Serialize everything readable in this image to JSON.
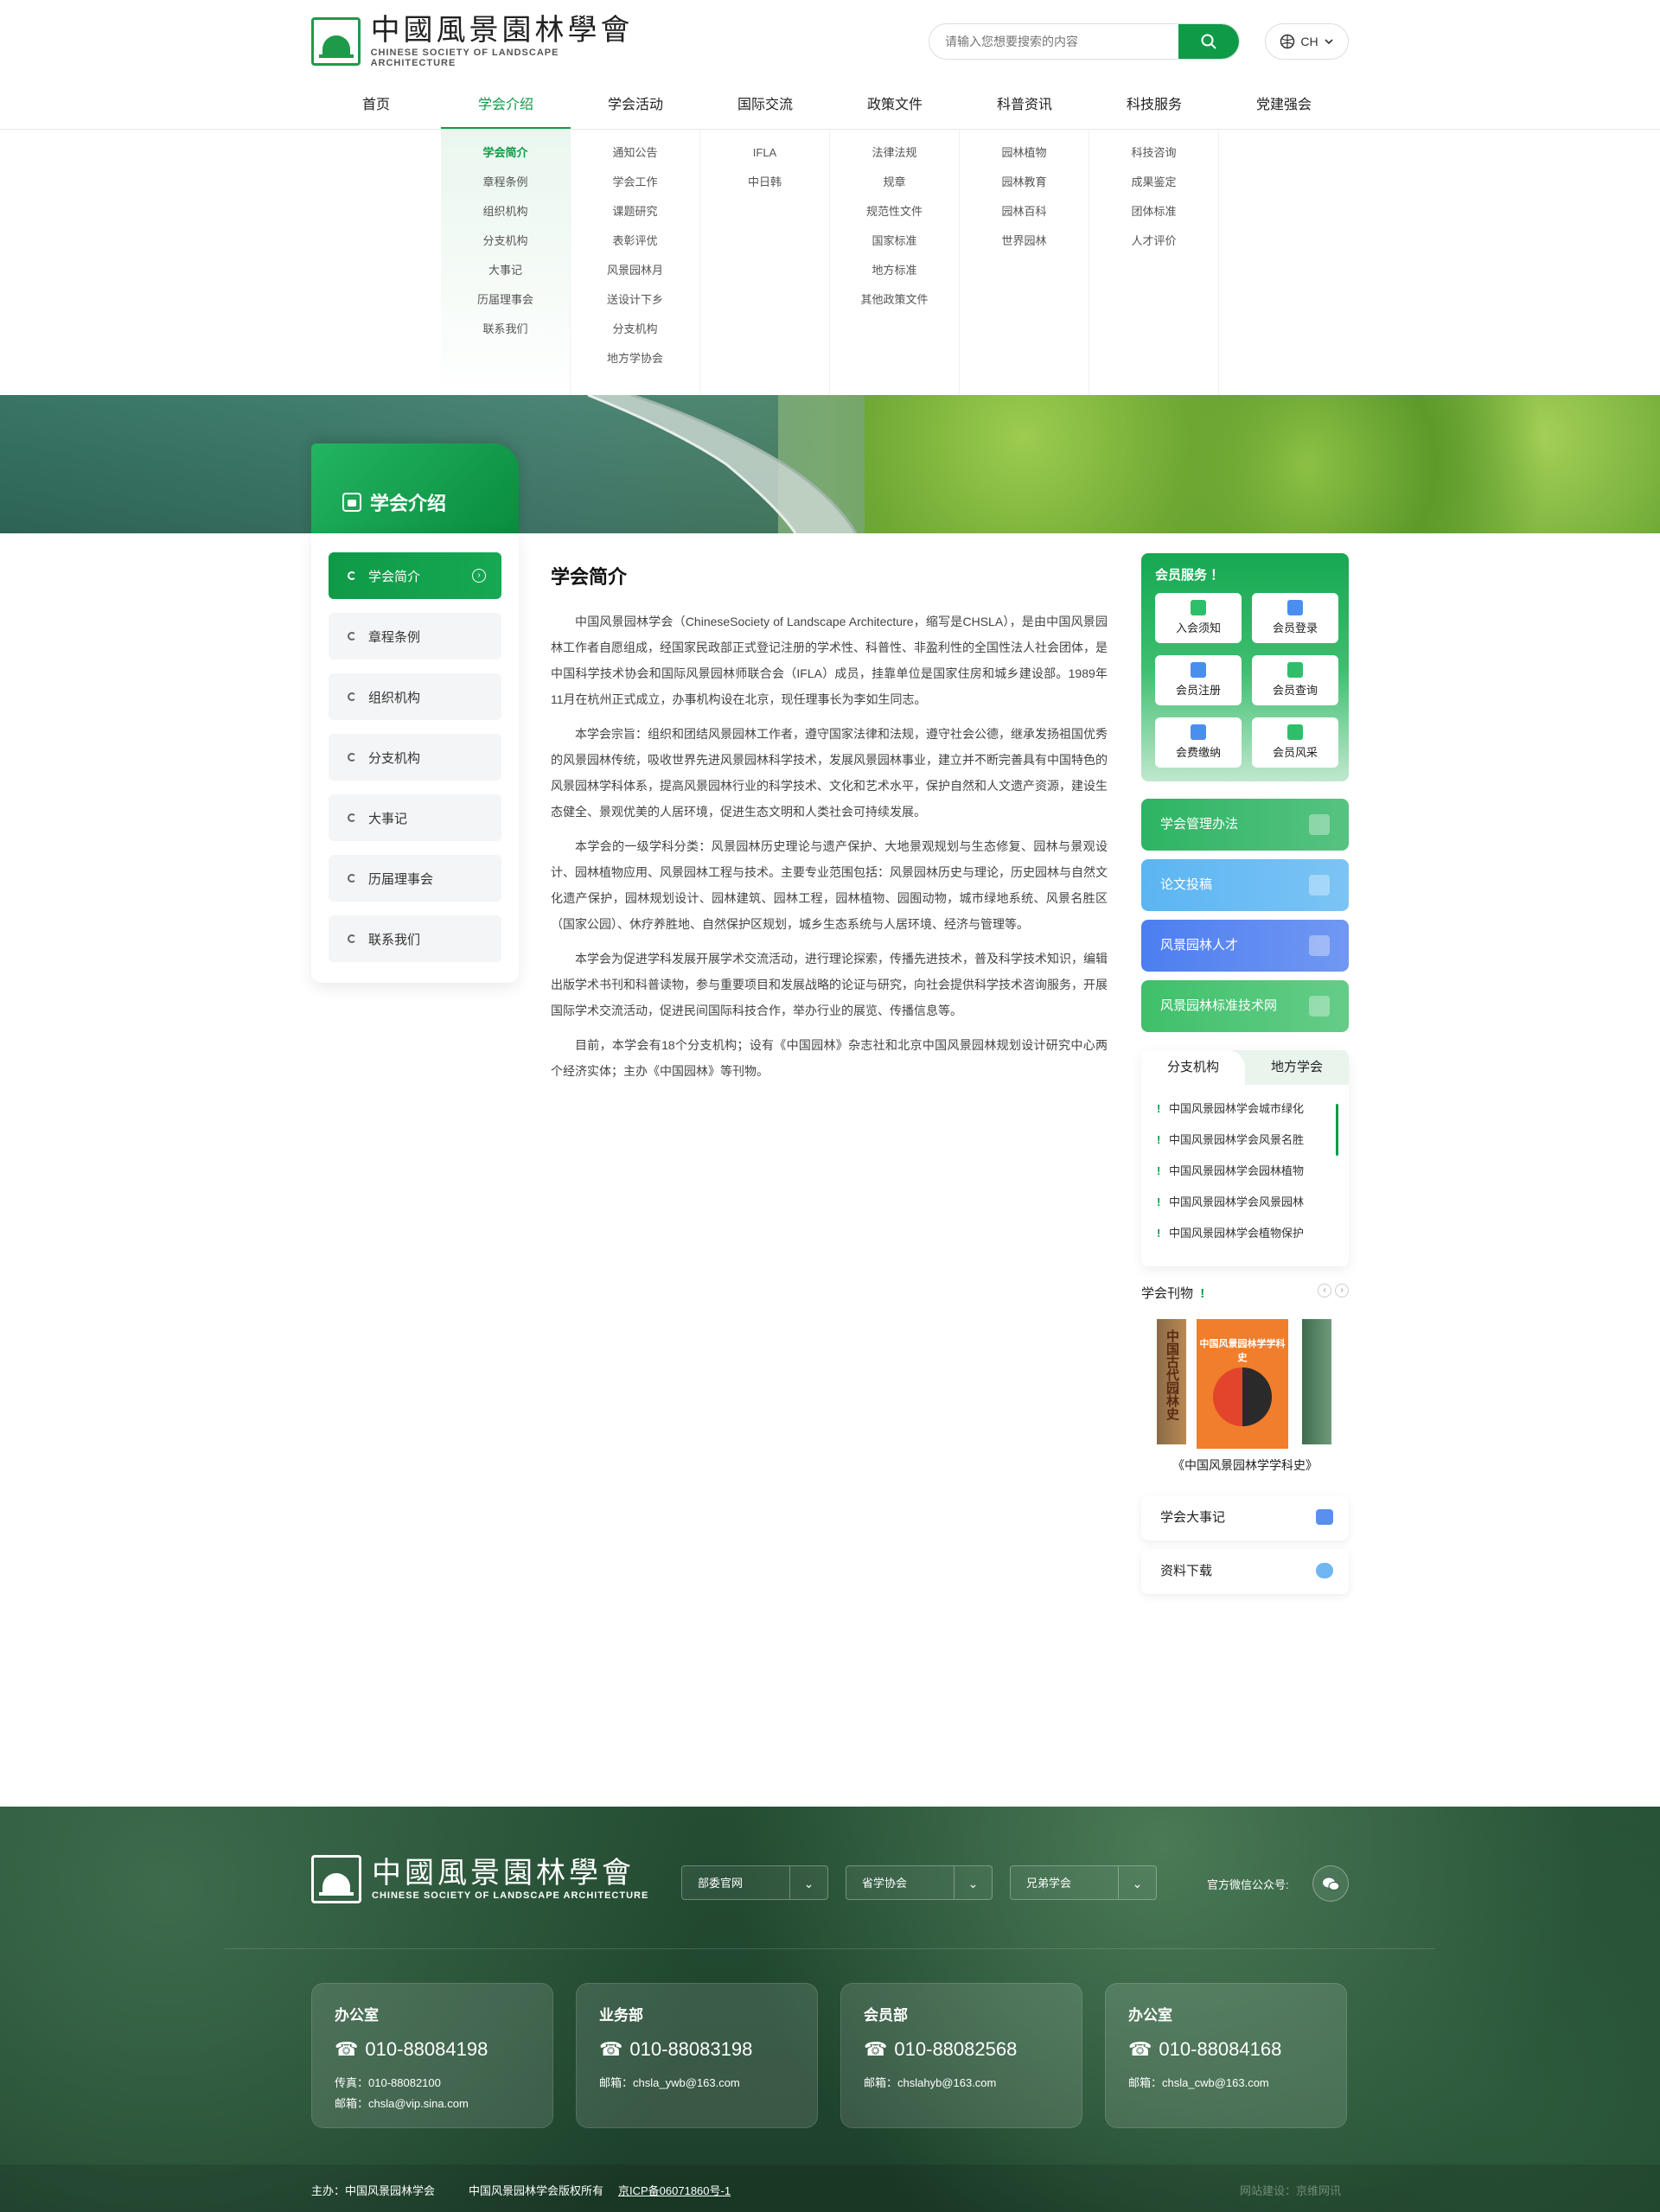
{
  "header": {
    "logo_cn": "中國風景園林學會",
    "logo_en": "CHINESE SOCIETY OF LANDSCAPE ARCHITECTURE",
    "search_placeholder": "请输入您想要搜索的内容",
    "lang": "CH"
  },
  "nav": [
    {
      "label": "首页"
    },
    {
      "label": "学会介绍",
      "active": true
    },
    {
      "label": "学会活动"
    },
    {
      "label": "国际交流"
    },
    {
      "label": "政策文件"
    },
    {
      "label": "科普资讯"
    },
    {
      "label": "科技服务"
    },
    {
      "label": "党建强会"
    }
  ],
  "dropdown": [
    [
      "学会简介",
      "章程条例",
      "组织机构",
      "分支机构",
      "大事记",
      "历届理事会",
      "联系我们"
    ],
    [
      "通知公告",
      "学会工作",
      "课题研究",
      "表彰评优",
      "风景园林月",
      "送设计下乡",
      "分支机构",
      "地方学协会"
    ],
    [
      "IFLA",
      "中日韩"
    ],
    [
      "法律法规",
      "规章",
      "规范性文件",
      "国家标准",
      "地方标准",
      "其他政策文件"
    ],
    [
      "园林植物",
      "园林教育",
      "园林百科",
      "世界园林"
    ],
    [
      "科技咨询",
      "成果鉴定",
      "团体标准",
      "人才评价"
    ]
  ],
  "page_tab": "学会介绍",
  "sidebar": [
    "学会简介",
    "章程条例",
    "组织机构",
    "分支机构",
    "大事记",
    "历届理事会",
    "联系我们"
  ],
  "article": {
    "title": "学会简介",
    "paragraphs": [
      "中国风景园林学会（ChineseSociety of Landscape Architecture，缩写是CHSLA），是由中国风景园林工作者自愿组成，经国家民政部正式登记注册的学术性、科普性、非盈利性的全国性法人社会团体，是中国科学技术协会和国际风景园林师联合会（IFLA）成员，挂靠单位是国家住房和城乡建设部。1989年11月在杭州正式成立，办事机构设在北京，现任理事长为李如生同志。",
      "本学会宗旨：组织和团结风景园林工作者，遵守国家法律和法规，遵守社会公德，继承发扬祖国优秀的风景园林传统，吸收世界先进风景园林科学技术，发展风景园林事业，建立并不断完善具有中国特色的风景园林学科体系，提高风景园林行业的科学技术、文化和艺术水平，保护自然和人文遗产资源，建设生态健全、景观优美的人居环境，促进生态文明和人类社会可持续发展。",
      "本学会的一级学科分类：风景园林历史理论与遗产保护、大地景观规划与生态修复、园林与景观设计、园林植物应用、风景园林工程与技术。主要专业范围包括：风景园林历史与理论，历史园林与自然文化遗产保护，园林规划设计、园林建筑、园林工程，园林植物、园囿动物，城市绿地系统、风景名胜区（国家公园）、休疗养胜地、自然保护区规划，城乡生态系统与人居环境、经济与管理等。",
      "本学会为促进学科发展开展学术交流活动，进行理论探索，传播先进技术，普及科学技术知识，编辑出版学术书刊和科普读物，参与重要项目和发展战略的论证与研究，向社会提供科学技术咨询服务，开展国际学术交流活动，促进民间国际科技合作，举办行业的展览、传播信息等。",
      "目前，本学会有18个分支机构；设有《中国园林》杂志社和北京中国风景园林规划设计研究中心两个经济实体；主办《中国园林》等刊物。"
    ]
  },
  "member_service": {
    "title": "会员服务 ！",
    "buttons": [
      "入会须知",
      "会员登录",
      "会员注册",
      "会员查询",
      "会费缴纳",
      "会员风采"
    ]
  },
  "quick_links": [
    {
      "label": "学会管理办法",
      "color": "#2db463"
    },
    {
      "label": "论文投稿",
      "color": "#5bb5f2"
    },
    {
      "label": "风景园林人才",
      "color": "#4d7ef0"
    },
    {
      "label": "风景园林标准技术网",
      "color": "#3fc06a"
    }
  ],
  "branch": {
    "tabs": [
      "分支机构",
      "地方学会"
    ],
    "items": [
      "中国风景园林学会城市绿化",
      "中国风景园林学会风景名胜",
      "中国风景园林学会园林植物",
      "中国风景园林学会风景园林",
      "中国风景园林学会植物保护"
    ]
  },
  "journals": {
    "title": "学会刊物",
    "book_left": "中国古代园林史",
    "book_center": "中国风景园林学学科史",
    "caption": "《中国风景园林学学科史》"
  },
  "extra_links": [
    "学会大事记",
    "资料下载"
  ],
  "footer": {
    "selects": [
      "部委官网",
      "省学协会",
      "兄弟学会"
    ],
    "wechat_label": "官方微信公众号:",
    "contacts": [
      {
        "title": "办公室",
        "phone": "010-88084198",
        "lines": [
          "传真：010-88082100",
          "邮箱：chsla@vip.sina.com"
        ]
      },
      {
        "title": "业务部",
        "phone": "010-88083198",
        "lines": [
          "邮箱：chsla_ywb@163.com"
        ]
      },
      {
        "title": "会员部",
        "phone": "010-88082568",
        "lines": [
          "邮箱：chslahyb@163.com"
        ]
      },
      {
        "title": "办公室",
        "phone": "010-88084168",
        "lines": [
          "邮箱：chsla_cwb@163.com"
        ]
      }
    ],
    "host": "主办：中国风景园林学会",
    "copyright": "中国风景园林学会版权所有",
    "icp": "京ICP备06071860号-1",
    "credit": "网站建设：京维网讯"
  },
  "colors": {
    "brand": "#0f9a48",
    "footer": "#1f4430"
  }
}
